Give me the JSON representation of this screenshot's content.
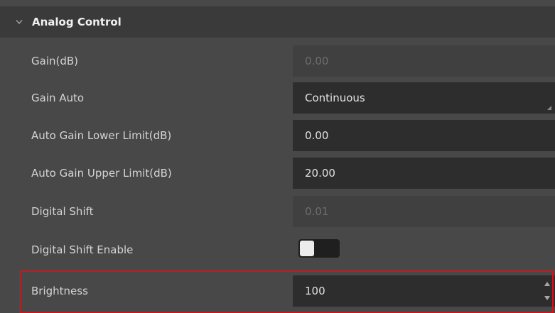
{
  "section": {
    "title": "Analog Control",
    "collapse_icon": "chevron-down-icon"
  },
  "params": [
    {
      "label": "Gain(dB)",
      "value": "0.00",
      "state": "disabled",
      "control": "text"
    },
    {
      "label": "Gain Auto",
      "value": "Continuous",
      "state": "enabled",
      "control": "dropdown"
    },
    {
      "label": "Auto Gain Lower Limit(dB)",
      "value": "0.00",
      "state": "enabled",
      "control": "text"
    },
    {
      "label": "Auto Gain Upper Limit(dB)",
      "value": "20.00",
      "state": "enabled",
      "control": "text"
    },
    {
      "label": "Digital Shift",
      "value": "0.01",
      "state": "disabled",
      "control": "text"
    },
    {
      "label": "Digital Shift Enable",
      "value": "off",
      "state": "enabled",
      "control": "toggle"
    },
    {
      "label": "Brightness",
      "value": "100",
      "state": "enabled",
      "control": "spinner",
      "highlighted": true
    }
  ],
  "colors": {
    "background": "#484848",
    "header": "#3a3a3a",
    "input_enabled": "#2d2d2d",
    "input_disabled": "#404040",
    "highlight": "#d2121b"
  }
}
